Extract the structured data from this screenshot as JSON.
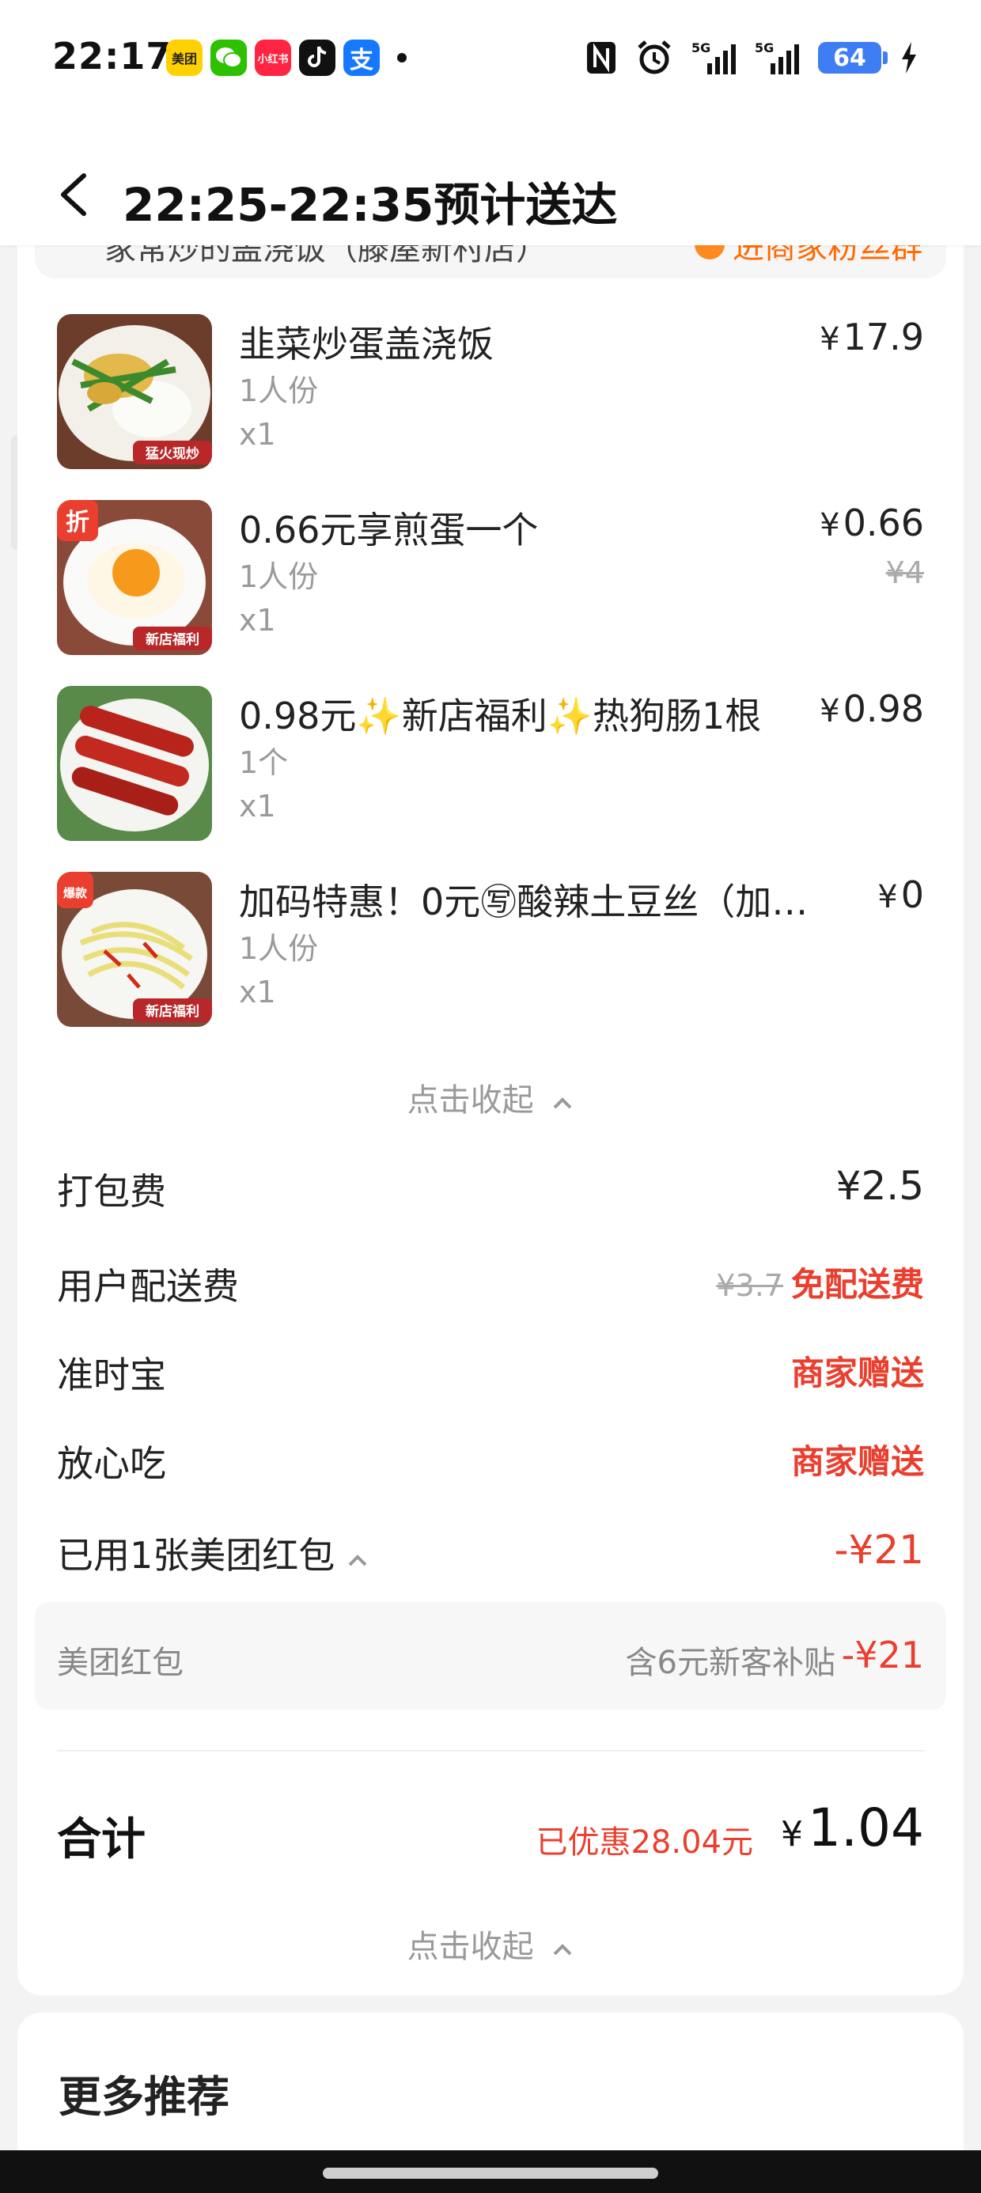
{
  "status_bar": {
    "time": "22:17",
    "apps": [
      {
        "name": "meituan-icon",
        "label": "美团",
        "color": "#ffd100",
        "text_color": "#222"
      },
      {
        "name": "wechat-icon",
        "label": "",
        "color": "#2dc100"
      },
      {
        "name": "xiaohongshu-icon",
        "label": "小红书",
        "color": "#ff2442"
      },
      {
        "name": "tiktok-icon",
        "label": "",
        "color": "#111111"
      },
      {
        "name": "alipay-icon",
        "label": "支",
        "color": "#1677ff"
      }
    ],
    "battery": "64",
    "signal_labels": [
      "5G",
      "5G"
    ]
  },
  "header": {
    "title": "22:25-22:35预计送达"
  },
  "store": {
    "name": "家常炒的盖浇饭（滕屋新村店）",
    "link": "进商家粉丝群"
  },
  "items": [
    {
      "name": "韭菜炒蛋盖浇饭",
      "spec": "1人份",
      "qty": "x1",
      "price": "17.9",
      "original": "",
      "badge": "猛火现炒"
    },
    {
      "name": "0.66元享煎蛋一个",
      "spec": "1人份",
      "qty": "x1",
      "price": "0.66",
      "original": "¥4",
      "badge": "新店福利",
      "corner": "折"
    },
    {
      "name": "0.98元✨新店福利✨热狗肠1根",
      "spec": "1个",
      "qty": "x1",
      "price": "0.98",
      "original": "",
      "badge": ""
    },
    {
      "name": "加码特惠！0元㊢酸辣土豆丝（加…",
      "spec": "1人份",
      "qty": "x1",
      "price": "0",
      "original": "",
      "badge": "新店福利",
      "corner": "爆款"
    }
  ],
  "collapse_label": "点击收起",
  "fees": {
    "packing_label": "打包费",
    "packing_value": "¥2.5",
    "delivery_label": "用户配送费",
    "delivery_original": "¥3.7",
    "delivery_value": "免配送费",
    "ontime_label": "准时宝",
    "ontime_value": "商家赠送",
    "safe_label": "放心吃",
    "safe_value": "商家赠送",
    "coupon_label": "已用1张美团红包",
    "coupon_value": "-¥21"
  },
  "coupon_detail": {
    "label": "美团红包",
    "note": "含6元新客补贴",
    "amount": "-¥21"
  },
  "total": {
    "label": "合计",
    "saved": "已优惠28.04元",
    "yen": "¥",
    "amount": "1.04"
  },
  "more": {
    "title": "更多推荐"
  },
  "colors": {
    "accent_red": "#ea3f2e",
    "accent_orange": "#ff6a00"
  }
}
